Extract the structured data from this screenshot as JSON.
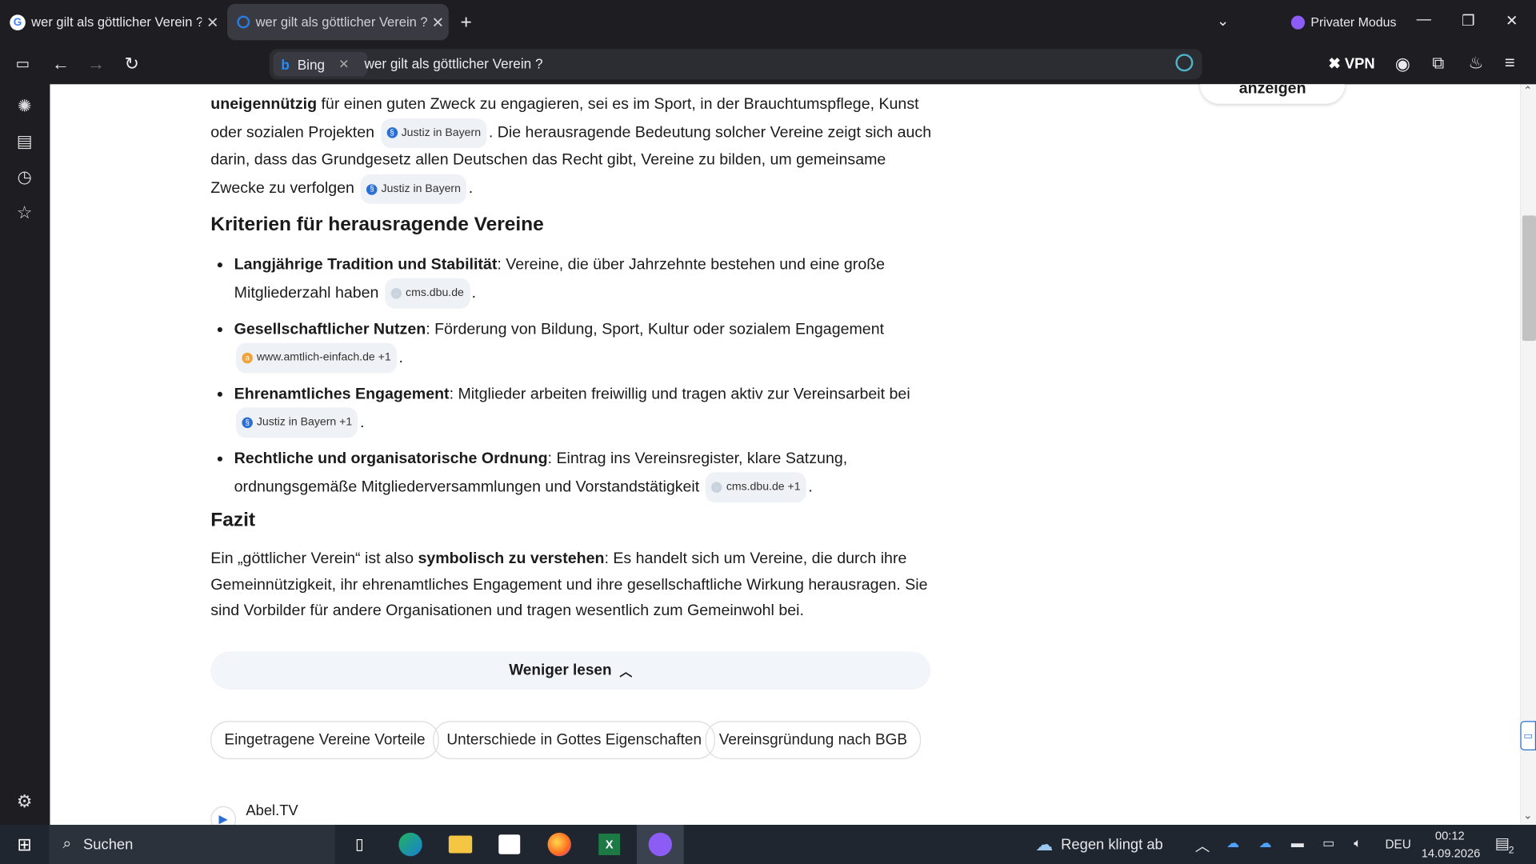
{
  "browser": {
    "tabs": [
      {
        "title": "wer gilt als göttlicher Verein ? -",
        "icon": "google-icon"
      },
      {
        "title": "wer gilt als göttlicher Verein ? -",
        "icon": "bing-search-icon"
      }
    ],
    "private_mode_label": "Privater Modus",
    "address_chip": "Bing",
    "address_text": "wer gilt als göttlicher Verein ?",
    "vpn_label": "VPN"
  },
  "article": {
    "float_button": "anzeigen",
    "intro": {
      "bold1": "uneigennützig",
      "text1": " für einen guten Zweck zu engagieren, sei es im Sport, in der Brauchtumspflege, Kunst oder sozialen Projekten ",
      "cite1": "Justiz in Bayern",
      "text2": ". Die herausragende Bedeutung solcher Vereine zeigt sich auch darin, dass das Grundgesetz allen Deutschen das Recht gibt, Vereine zu bilden, um gemeinsame Zwecke zu verfolgen ",
      "cite2": "Justiz in Bayern",
      "text3": "."
    },
    "heading_criteria": "Kriterien für herausragende Vereine",
    "criteria": [
      {
        "bold": "Langjährige Tradition und Stabilität",
        "text": ": Vereine, die über Jahrzehnte bestehen und eine große Mitgliederzahl haben ",
        "cite": "cms.dbu.de"
      },
      {
        "bold": "Gesellschaftlicher Nutzen",
        "text": ": Förderung von Bildung, Sport, Kultur oder sozialem Engagement ",
        "cite": "www.amtlich-einfach.de +1"
      },
      {
        "bold": "Ehrenamtliches Engagement",
        "text": ": Mitglieder arbeiten freiwillig und tragen aktiv zur Vereinsarbeit bei ",
        "cite": "Justiz in Bayern +1"
      },
      {
        "bold": "Rechtliche und organisatorische Ordnung",
        "text": ": Eintrag ins Vereinsregister, klare Satzung, ordnungsgemäße Mitgliederversammlungen und Vorstandstätigkeit ",
        "cite": "cms.dbu.de +1"
      }
    ],
    "heading_fazit": "Fazit",
    "fazit": {
      "text1": "Ein „göttlicher Verein“ ist also ",
      "bold": "symbolisch zu verstehen",
      "text2": ": Es handelt sich um Vereine, die durch ihre Gemeinnützigkeit, ihr ehrenamtliches Engagement und ihre gesellschaftliche Wirkung herausragen. Sie sind Vorbilder für andere Organisationen und tragen wesentlich zum Gemeinwohl bei."
    },
    "less_button": "Weniger lesen",
    "suggestions": [
      "Eingetragene Vereine Vorteile",
      "Unterschiede in Gottes Eigenschaften",
      "Vereinsgründung nach BGB"
    ],
    "result_site": "Abel.TV"
  },
  "taskbar": {
    "search_placeholder": "Suchen",
    "weather": "Regen klingt ab",
    "language": "DEU",
    "time": "00:12",
    "date": "14.09.2026",
    "notifications": "2"
  }
}
